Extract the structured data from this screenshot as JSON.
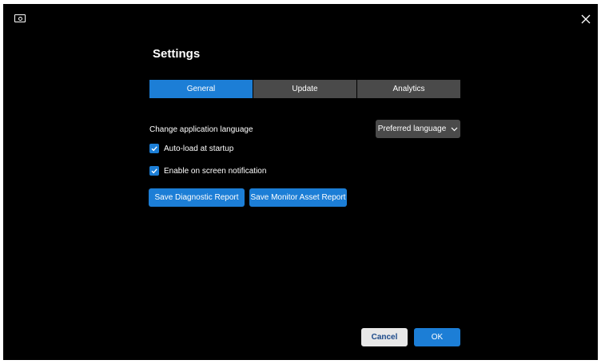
{
  "window": {
    "app_icon": "monitor-icon",
    "close_icon": "close-icon"
  },
  "settings": {
    "title": "Settings",
    "tabs": [
      {
        "label": "General",
        "active": true
      },
      {
        "label": "Update",
        "active": false
      },
      {
        "label": "Analytics",
        "active": false
      }
    ],
    "language": {
      "label": "Change application language",
      "selected": "Preferred language"
    },
    "checkboxes": [
      {
        "label": "Auto-load at startup",
        "checked": true
      },
      {
        "label": "Enable on screen notification",
        "checked": true
      }
    ],
    "buttons": {
      "diagnostic": "Save Diagnostic Report",
      "asset": "Save Monitor Asset Report"
    }
  },
  "footer": {
    "cancel": "Cancel",
    "ok": "OK"
  },
  "colors": {
    "accent": "#1c7ed6",
    "background": "#000000",
    "tab_inactive": "#4a4a4a",
    "cancel_bg": "#e8e8e8"
  }
}
